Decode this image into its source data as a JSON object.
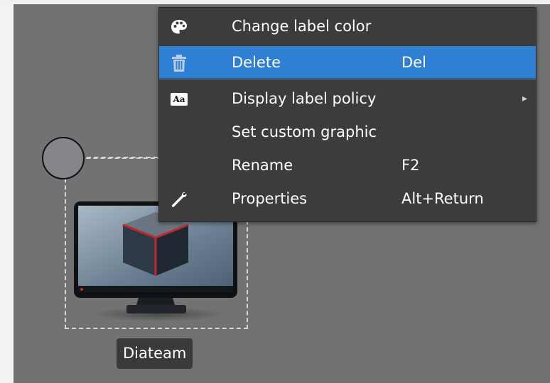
{
  "node": {
    "label": "Diateam",
    "icon": "monitor-cube-icon"
  },
  "context_menu": {
    "items": [
      {
        "label": "Change label color",
        "shortcut": "",
        "icon": "palette-icon",
        "highlighted": false,
        "has_submenu": false
      },
      {
        "label": "Delete",
        "shortcut": "Del",
        "icon": "trash-icon",
        "highlighted": true,
        "has_submenu": false
      },
      {
        "label": "Display label policy",
        "shortcut": "",
        "icon": "font-aa-icon",
        "icon_text": "Aa",
        "highlighted": false,
        "has_submenu": true
      },
      {
        "label": "Set custom graphic",
        "shortcut": "",
        "icon": "",
        "highlighted": false,
        "has_submenu": false
      },
      {
        "label": "Rename",
        "shortcut": "F2",
        "icon": "",
        "highlighted": false,
        "has_submenu": false
      },
      {
        "label": "Properties",
        "shortcut": "Alt+Return",
        "icon": "wrench-icon",
        "highlighted": false,
        "has_submenu": false
      }
    ],
    "submenu_arrow": "▸"
  },
  "colors": {
    "canvas": "#727272",
    "menu_background": "#3c3c3c",
    "menu_highlight": "#2f7fd4",
    "label_background": "#3a3a3a"
  }
}
